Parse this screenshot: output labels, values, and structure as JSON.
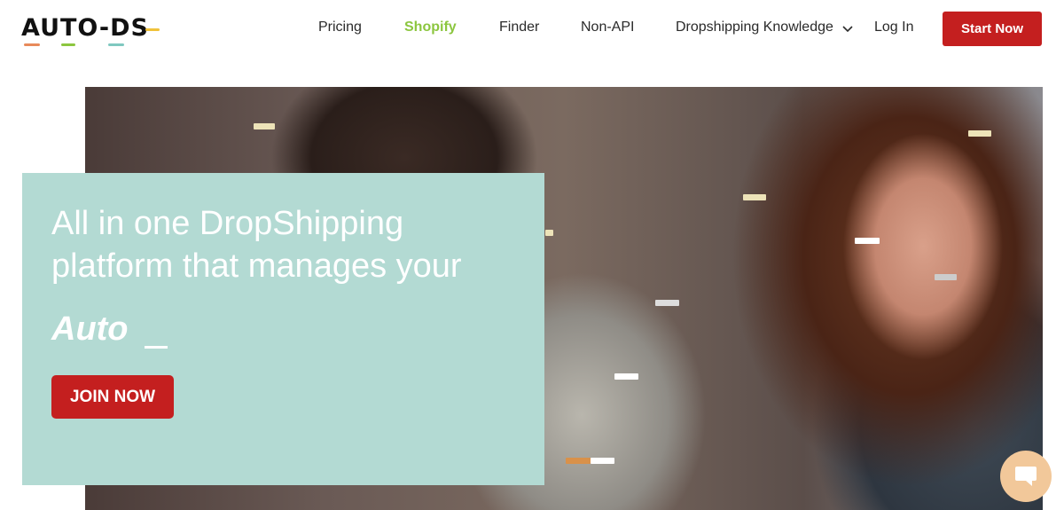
{
  "brand": {
    "logo_text": "AUTO-DS"
  },
  "nav": {
    "pricing": "Pricing",
    "shopify": "Shopify",
    "finder": "Finder",
    "non_api": "Non-API",
    "knowledge": "Dropshipping Knowledge",
    "login": "Log In",
    "start": "Start Now"
  },
  "hero": {
    "headline_line1": "All in one DropShipping",
    "headline_line2": "platform that manages your",
    "typed_word": "Auto",
    "cta": "JOIN NOW"
  },
  "icons": {
    "dropdown": "chevron-down-icon",
    "chat": "chat-bubble-icon"
  },
  "colors": {
    "accent_red": "#c41f1f",
    "shopify_green": "#8cc63f",
    "card_mint": "#b3dad3",
    "chat_bg": "#f2c89a"
  }
}
